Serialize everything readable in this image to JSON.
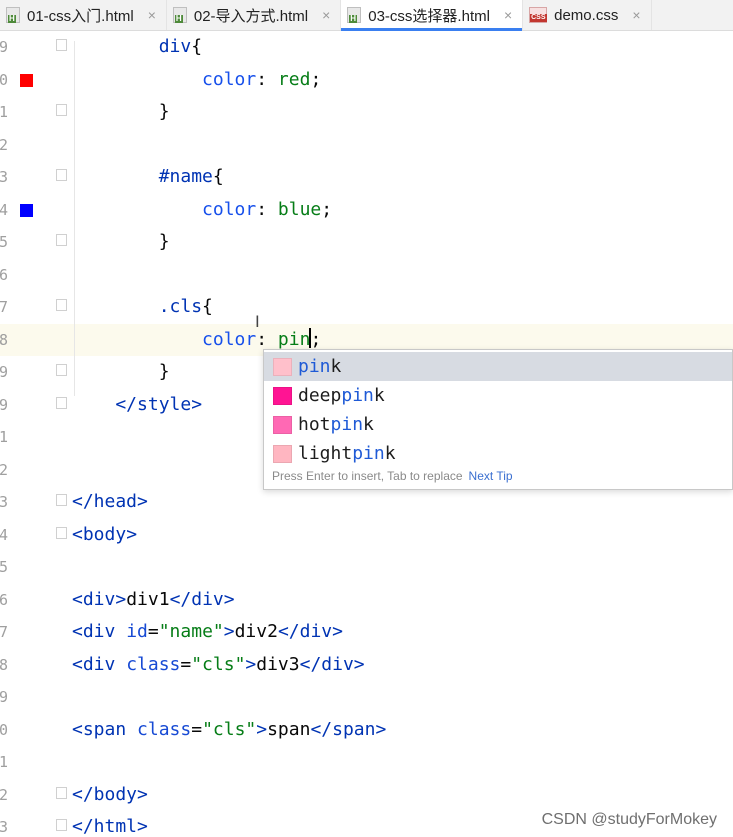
{
  "tabs": [
    {
      "label": "01-css入门.html",
      "type": "html",
      "active": false,
      "close": "×"
    },
    {
      "label": "02-导入方式.html",
      "type": "html",
      "active": false,
      "close": "×"
    },
    {
      "label": "03-css选择器.html",
      "type": "html",
      "active": true,
      "close": "×"
    },
    {
      "label": "demo.css",
      "type": "css",
      "active": false,
      "close": "×"
    }
  ],
  "editor": {
    "lines": [
      {
        "num": "9",
        "fold": true,
        "tokens": [
          [
            "sel",
            "        div"
          ],
          [
            "txt",
            "{"
          ]
        ]
      },
      {
        "num": "0",
        "swatch": "#ff0000",
        "tokens": [
          [
            "prop",
            "            color"
          ],
          [
            "txt",
            ": "
          ],
          [
            "val",
            "red"
          ],
          [
            "txt",
            ";"
          ]
        ]
      },
      {
        "num": "1",
        "fold": true,
        "tokens": [
          [
            "txt",
            "        }"
          ]
        ]
      },
      {
        "num": "2",
        "tokens": []
      },
      {
        "num": "3",
        "fold": true,
        "tokens": [
          [
            "sel",
            "        #name"
          ],
          [
            "txt",
            "{"
          ]
        ]
      },
      {
        "num": "4",
        "swatch": "#0000ff",
        "tokens": [
          [
            "prop",
            "            color"
          ],
          [
            "txt",
            ": "
          ],
          [
            "val",
            "blue"
          ],
          [
            "txt",
            ";"
          ]
        ]
      },
      {
        "num": "5",
        "fold": true,
        "tokens": [
          [
            "txt",
            "        }"
          ]
        ]
      },
      {
        "num": "6",
        "tokens": []
      },
      {
        "num": "7",
        "fold": true,
        "tokens": [
          [
            "sel",
            "        .cls"
          ],
          [
            "txt",
            "{"
          ]
        ]
      },
      {
        "num": "8",
        "current": true,
        "tokens": [
          [
            "prop",
            "            color"
          ],
          [
            "txt",
            ": "
          ],
          [
            "val",
            "pin"
          ],
          [
            "caret",
            ""
          ],
          [
            "txt",
            ";"
          ]
        ]
      },
      {
        "num": "9",
        "fold": true,
        "tokens": [
          [
            "txt",
            "        }"
          ]
        ]
      },
      {
        "num": "9",
        "fold": true,
        "tokens": [
          [
            "tag",
            "    </style"
          ],
          [
            "tag",
            ">"
          ]
        ]
      },
      {
        "num": "1",
        "tokens": []
      },
      {
        "num": "2",
        "tokens": []
      },
      {
        "num": "3",
        "fold": true,
        "tokens": [
          [
            "tag",
            "</head"
          ],
          [
            "tag",
            ">"
          ]
        ]
      },
      {
        "num": "4",
        "fold": true,
        "tokens": [
          [
            "tag",
            "<body"
          ],
          [
            "tag",
            ">"
          ]
        ]
      },
      {
        "num": "5",
        "tokens": []
      },
      {
        "num": "6",
        "tokens": [
          [
            "tag",
            "<div"
          ],
          [
            "tag",
            ">"
          ],
          [
            "txt",
            "div1"
          ],
          [
            "tag",
            "</div"
          ],
          [
            "tag",
            ">"
          ]
        ]
      },
      {
        "num": "7",
        "tokens": [
          [
            "tag",
            "<div "
          ],
          [
            "attr",
            "id"
          ],
          [
            "txt",
            "="
          ],
          [
            "str",
            "\"name\""
          ],
          [
            "tag",
            ">"
          ],
          [
            "txt",
            "div2"
          ],
          [
            "tag",
            "</div"
          ],
          [
            "tag",
            ">"
          ]
        ]
      },
      {
        "num": "8",
        "tokens": [
          [
            "tag",
            "<div "
          ],
          [
            "attr",
            "class"
          ],
          [
            "txt",
            "="
          ],
          [
            "str",
            "\"cls\""
          ],
          [
            "tag",
            ">"
          ],
          [
            "txt",
            "div3"
          ],
          [
            "tag",
            "</div"
          ],
          [
            "tag",
            ">"
          ]
        ]
      },
      {
        "num": "9",
        "tokens": []
      },
      {
        "num": "0",
        "tokens": [
          [
            "tag",
            "<span "
          ],
          [
            "attr",
            "class"
          ],
          [
            "txt",
            "="
          ],
          [
            "str",
            "\"cls\""
          ],
          [
            "tag",
            ">"
          ],
          [
            "txt",
            "span"
          ],
          [
            "tag",
            "</span"
          ],
          [
            "tag",
            ">"
          ]
        ]
      },
      {
        "num": "1",
        "tokens": []
      },
      {
        "num": "2",
        "fold": true,
        "tokens": [
          [
            "tag",
            "</body"
          ],
          [
            "tag",
            ">"
          ]
        ]
      },
      {
        "num": "3",
        "fold": true,
        "tokens": [
          [
            "tag",
            "</html"
          ],
          [
            "tag",
            ">"
          ]
        ]
      }
    ]
  },
  "autocomplete": {
    "items": [
      {
        "prefix": "",
        "match": "pin",
        "suffix": "k",
        "color": "#ffc0cb",
        "selected": true
      },
      {
        "prefix": "deep",
        "match": "pin",
        "suffix": "k",
        "color": "#ff1493",
        "selected": false
      },
      {
        "prefix": "hot",
        "match": "pin",
        "suffix": "k",
        "color": "#ff69b4",
        "selected": false
      },
      {
        "prefix": "light",
        "match": "pin",
        "suffix": "k",
        "color": "#ffb6c1",
        "selected": false
      }
    ],
    "hint": "Press Enter to insert, Tab to replace",
    "next_tip": "Next Tip"
  },
  "watermark": "CSDN @studyForMokey"
}
